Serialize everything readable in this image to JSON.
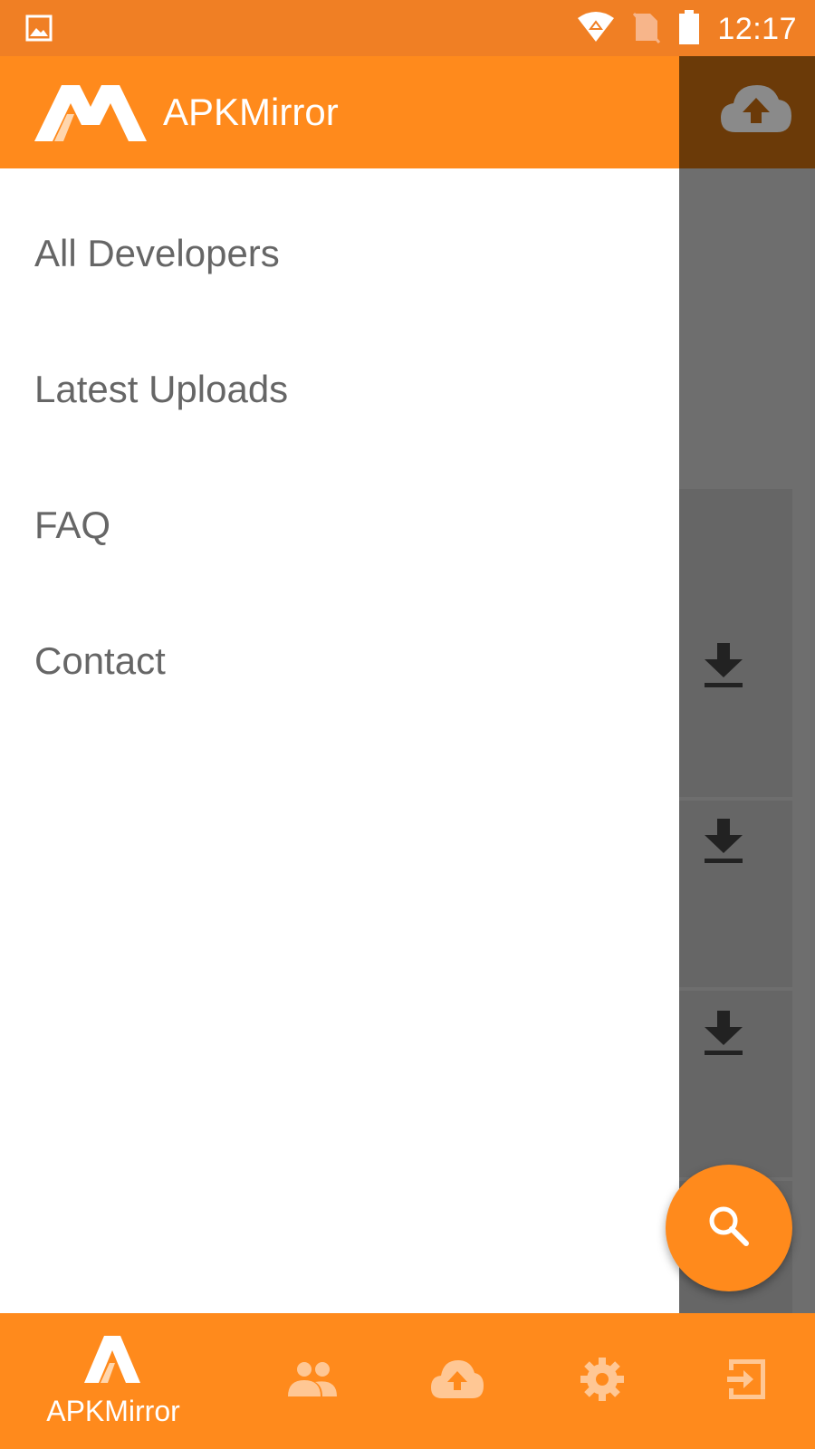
{
  "status_bar": {
    "time": "12:17",
    "icons": [
      "image-icon",
      "wifi-icon",
      "no-sim-icon",
      "battery-icon"
    ]
  },
  "drawer": {
    "title": "APKMirror",
    "items": [
      {
        "label": "All Developers"
      },
      {
        "label": "Latest Uploads"
      },
      {
        "label": "FAQ"
      },
      {
        "label": "Contact"
      }
    ]
  },
  "background": {
    "toolbar_icons": [
      "upload-cloud-icon"
    ],
    "list_icons": [
      "download-icon",
      "download-icon",
      "download-icon"
    ]
  },
  "fab": {
    "icon": "search-icon"
  },
  "bottom_nav": {
    "items": [
      {
        "label": "APKMirror",
        "icon": "apkmirror-logo-icon"
      },
      {
        "label": "",
        "icon": "people-icon"
      },
      {
        "label": "",
        "icon": "upload-cloud-icon"
      },
      {
        "label": "",
        "icon": "settings-gear-icon"
      },
      {
        "label": "",
        "icon": "logout-icon"
      }
    ]
  },
  "colors": {
    "accent": "#ff8a1c",
    "status_bar": "#f07f24",
    "scrim": "#6e6e6e",
    "drawer_text": "#666666"
  }
}
